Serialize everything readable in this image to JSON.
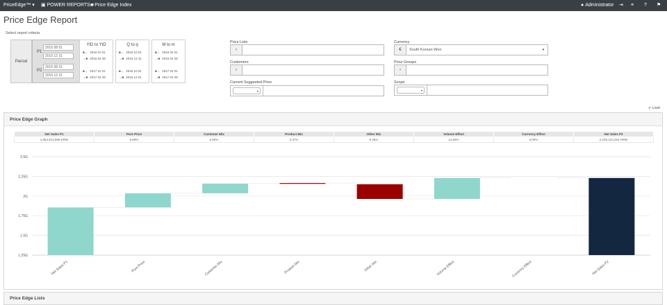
{
  "topbar": {
    "brand": "PriceEdge™",
    "menu_power_reports": "POWER REPORTS",
    "menu_price_edge_index": "Price Edge Index",
    "user": "Administrator"
  },
  "page": {
    "title": "Price Edge Report",
    "criteria_label": "Select report criteria"
  },
  "period": {
    "label": "Period",
    "p1_label": "P1",
    "p1_from": "2015 08 01",
    "p1_to": "2015 12 31",
    "p2_label": "P2",
    "p2_from": "2016 08 01",
    "p2_to": "2016 12 31",
    "options": [
      {
        "title": "YtD to YtD",
        "rows": [
          "2016 01 01",
          "2016 02 28",
          "2017 01 01",
          "2017 02 28"
        ]
      },
      {
        "title": "Q to q",
        "rows": [
          "2015 10 01",
          "2016 12 31",
          "2016 10 01",
          "2016 12 01"
        ]
      },
      {
        "title": "M to m",
        "rows": [
          "2016 02 01",
          "2016 02 28",
          "2017 02 01",
          "2017 02 28"
        ]
      }
    ]
  },
  "filters": {
    "price_lists_label": "Price Lists",
    "customers_label": "Customers",
    "current_suggested_price_label": "Current Suggested Price",
    "currency_label": "Currency",
    "currency_value": "South Korean Won",
    "price_groups_label": "Price Groups",
    "scope_label": "Scope"
  },
  "load_label": "Load",
  "graph_panel": {
    "title": "Price Edge Graph",
    "summary_headers": [
      "Net Sales P1",
      "Pure Price",
      "Customer Mix",
      "Product Mix",
      "Other Mix",
      "Volume Effect",
      "Currency Effect",
      "Net Sales P2"
    ],
    "summary_values": [
      "1,854,914,596 KRW",
      "9.68%",
      "6.60%",
      "0.37%",
      "9.45%",
      "14.69%",
      "0.00%",
      "2,229,123,264 KRW"
    ]
  },
  "lists_panel": {
    "title": "Price Edge Lists"
  },
  "colors": {
    "positive": "#8fd6cc",
    "negative": "#9b0000",
    "total": "#132741",
    "topbar": "#3a3f44"
  },
  "chart_data": {
    "type": "bar",
    "subtype": "waterfall",
    "categories": [
      "Net Sales P1",
      "Pure Price",
      "Customer Mix",
      "Product Mix",
      "Other Mix",
      "Volume Effect",
      "Currency Effect",
      "Net Sales P2"
    ],
    "bars": [
      {
        "kind": "total",
        "start": 1.25,
        "end": 1.855
      },
      {
        "kind": "increase",
        "start": 1.855,
        "end": 2.035
      },
      {
        "kind": "increase",
        "start": 2.035,
        "end": 2.158
      },
      {
        "kind": "increase",
        "start": 2.158,
        "end": 2.165
      },
      {
        "kind": "decrease",
        "start": 2.15,
        "end": 1.963
      },
      {
        "kind": "increase",
        "start": 1.963,
        "end": 2.229
      },
      {
        "kind": "none",
        "start": 2.229,
        "end": 2.229
      },
      {
        "kind": "total",
        "start": 1.25,
        "end": 2.229
      }
    ],
    "yticks": [
      "1.25G",
      "1.5G",
      "1.75G",
      "2G",
      "2.25G",
      "2.5G"
    ],
    "ylim": [
      1.25,
      2.5
    ],
    "grid": true
  }
}
